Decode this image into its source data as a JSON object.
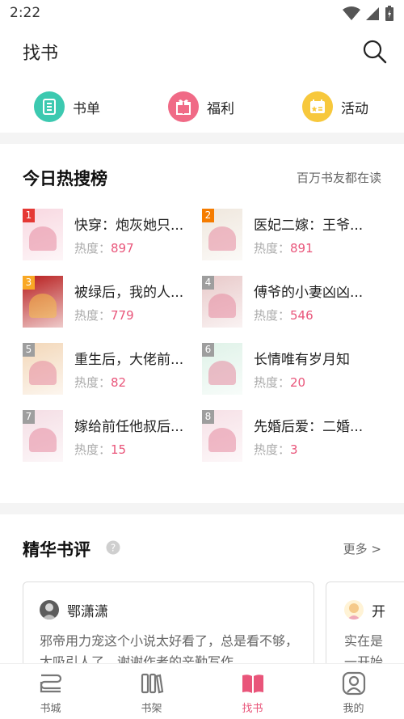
{
  "status": {
    "time": "2:22"
  },
  "header": {
    "title": "找书"
  },
  "quick_links": [
    {
      "label": "书单",
      "icon": "booklist-icon",
      "color": "#3cc9b0"
    },
    {
      "label": "福利",
      "icon": "gift-icon",
      "color": "#f06a86"
    },
    {
      "label": "活动",
      "icon": "ticket-icon",
      "color": "#f7c83c"
    }
  ],
  "hot_search": {
    "title": "今日热搜榜",
    "subtitle": "百万书友都在读",
    "heat_label": "热度：",
    "items": [
      {
        "rank": "1",
        "title": "快穿：炮灰她只...",
        "heat": "897"
      },
      {
        "rank": "2",
        "title": "医妃二嫁：王爷...",
        "heat": "891"
      },
      {
        "rank": "3",
        "title": "被绿后，我的人...",
        "heat": "779"
      },
      {
        "rank": "4",
        "title": "傅爷的小妻凶凶...",
        "heat": "546"
      },
      {
        "rank": "5",
        "title": "重生后，大佬前...",
        "heat": "82"
      },
      {
        "rank": "6",
        "title": "长情唯有岁月知",
        "heat": "20"
      },
      {
        "rank": "7",
        "title": "嫁给前任他叔后...",
        "heat": "15"
      },
      {
        "rank": "8",
        "title": "先婚后爱：二婚...",
        "heat": "3"
      }
    ],
    "rank_colors": [
      "#e53935",
      "#f57c00",
      "#f9a825",
      "#9e9e9e",
      "#9e9e9e",
      "#9e9e9e",
      "#9e9e9e",
      "#9e9e9e"
    ],
    "cover_colors": [
      "#f8d7e0",
      "#efe7dd",
      "#b71c1c",
      "#e8c9c9",
      "#f3d7b8",
      "#dff2e8",
      "#f4dde4",
      "#f6e0e6"
    ]
  },
  "reviews": {
    "title": "精华书评",
    "more": "更多 >",
    "help_icon": "question-icon",
    "cards": [
      {
        "user": "鄂潇潇",
        "text": "邪帝用力宠这个小说太好看了，总是看不够，太吸引人了，谢谢作者的辛勤写作"
      },
      {
        "user": "开",
        "text": "实在是一开始"
      }
    ]
  },
  "bottom_nav": [
    {
      "label": "书城",
      "icon": "bookstore-icon",
      "active": false
    },
    {
      "label": "书架",
      "icon": "bookshelf-icon",
      "active": false
    },
    {
      "label": "找书",
      "icon": "findbook-icon",
      "active": true
    },
    {
      "label": "我的",
      "icon": "profile-icon",
      "active": false
    }
  ]
}
